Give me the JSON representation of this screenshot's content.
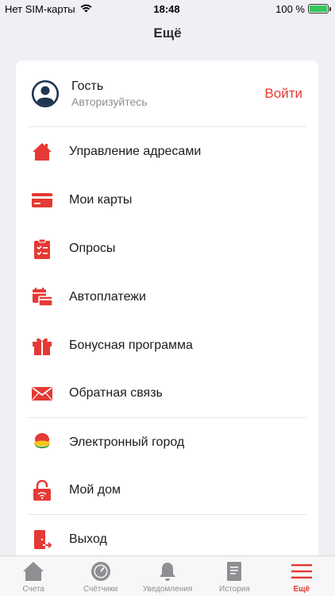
{
  "status_bar": {
    "carrier": "Нет SIM-карты",
    "time": "18:48",
    "battery": "100 %",
    "battery_level": 1.0
  },
  "nav": {
    "title": "Ещё"
  },
  "profile": {
    "name": "Гость",
    "subtitle": "Авторизуйтесь",
    "login_label": "Войти"
  },
  "menu": [
    {
      "label": "Управление адресами",
      "icon": "house-icon"
    },
    {
      "label": "Мои карты",
      "icon": "card-icon"
    },
    {
      "label": "Опросы",
      "icon": "clipboard-icon"
    },
    {
      "label": "Автоплатежи",
      "icon": "calendar-card-icon"
    },
    {
      "label": "Бонусная программа",
      "icon": "gift-icon"
    },
    {
      "label": "Обратная связь",
      "icon": "envelope-icon"
    },
    {
      "label": "Электронный город",
      "icon": "city-logo-icon"
    },
    {
      "label": "Мой дом",
      "icon": "smart-lock-icon"
    },
    {
      "label": "Выход",
      "icon": "exit-door-icon"
    }
  ],
  "tabs": [
    {
      "label": "Счета",
      "icon": "house-icon",
      "active": false
    },
    {
      "label": "Счётчики",
      "icon": "meter-icon",
      "active": false
    },
    {
      "label": "Уведомления",
      "icon": "bell-icon",
      "active": false
    },
    {
      "label": "История",
      "icon": "document-icon",
      "active": false
    },
    {
      "label": "Ещё",
      "icon": "hamburger-icon",
      "active": true
    }
  ],
  "colors": {
    "accent": "#e53935",
    "background": "#efeff4",
    "card": "#ffffff",
    "tab_inactive": "#8e8e93"
  }
}
